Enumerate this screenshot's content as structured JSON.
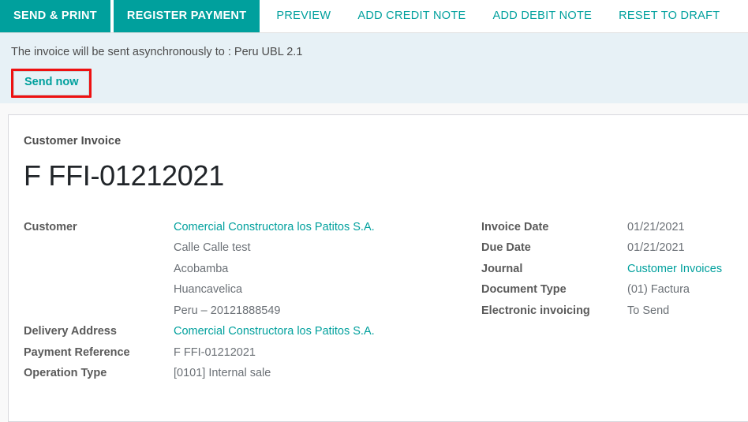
{
  "statusbar": {
    "buttons": [
      {
        "label": "SEND & PRINT",
        "style": "primary"
      },
      {
        "label": "REGISTER PAYMENT",
        "style": "primary"
      },
      {
        "label": "PREVIEW",
        "style": "link"
      },
      {
        "label": "ADD CREDIT NOTE",
        "style": "link"
      },
      {
        "label": "ADD DEBIT NOTE",
        "style": "link"
      },
      {
        "label": "RESET TO DRAFT",
        "style": "link"
      }
    ]
  },
  "alert": {
    "message": "The invoice will be sent asynchronously to : Peru UBL 2.1",
    "send_now_label": "Send now",
    "highlight_color": "#ee1111",
    "background_color": "#e7f1f6"
  },
  "sheet": {
    "document_type_label": "Customer Invoice",
    "document_number": "F FFI-01212021",
    "left_fields": [
      {
        "label": "Customer",
        "value_lines": [
          {
            "text": "Comercial Constructora los Patitos S.A.",
            "link": true
          },
          {
            "text": "Calle Calle test",
            "link": false
          },
          {
            "text": "Acobamba",
            "link": false
          },
          {
            "text": "Huancavelica",
            "link": false
          },
          {
            "text": "Peru – 20121888549",
            "link": false
          }
        ]
      },
      {
        "label": "Delivery Address",
        "value_lines": [
          {
            "text": "Comercial Constructora los Patitos S.A.",
            "link": true
          }
        ]
      },
      {
        "label": "Payment Reference",
        "value_lines": [
          {
            "text": "F FFI-01212021",
            "link": false
          }
        ]
      },
      {
        "label": "Operation Type",
        "value_lines": [
          {
            "text": "[0101] Internal sale",
            "link": false
          }
        ]
      }
    ],
    "right_fields": [
      {
        "label": "Invoice Date",
        "value_lines": [
          {
            "text": "01/21/2021",
            "link": false
          }
        ]
      },
      {
        "label": "Due Date",
        "value_lines": [
          {
            "text": "01/21/2021",
            "link": false
          }
        ]
      },
      {
        "label": "Journal",
        "value_lines": [
          {
            "text": "Customer Invoices",
            "link": true
          }
        ]
      },
      {
        "label": "Document Type",
        "value_lines": [
          {
            "text": "(01) Factura",
            "link": false
          }
        ]
      },
      {
        "label": "Electronic invoicing",
        "value_lines": [
          {
            "text": "To Send",
            "link": false
          }
        ]
      }
    ]
  },
  "theme": {
    "accent": "#00a09d",
    "text": "#4c4c4c",
    "value_text": "#6b7076"
  }
}
